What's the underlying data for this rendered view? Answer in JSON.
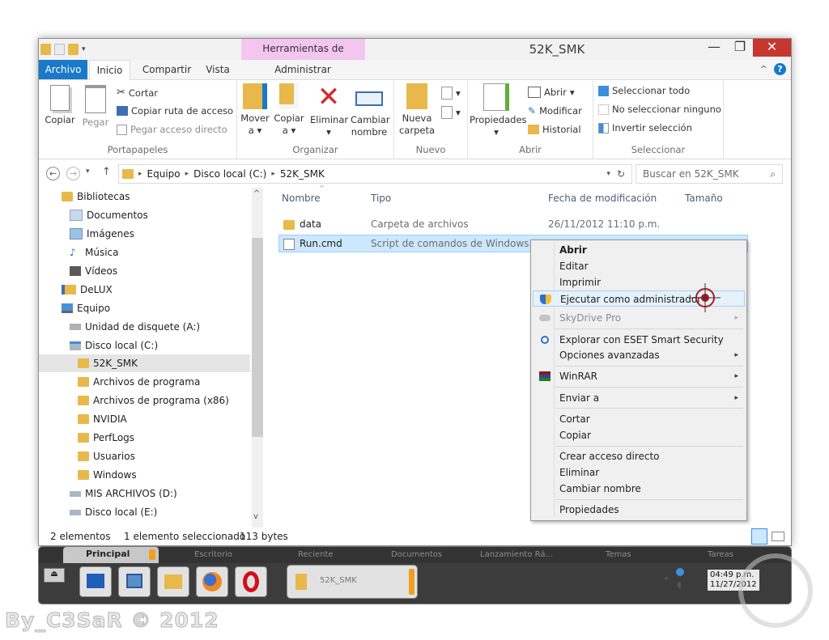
{
  "window": {
    "title": "52K_SMK",
    "context_tab_title": "Herramientas de aplicación",
    "controls": {
      "minimize": "—",
      "maximize": "❐",
      "close": "✕"
    }
  },
  "tabs": [
    "Archivo",
    "Inicio",
    "Compartir",
    "Vista",
    "Administrar"
  ],
  "ribbon": {
    "portapapeles": {
      "label": "Portapapeles",
      "copiar": "Copiar",
      "pegar": "Pegar",
      "cortar": "Cortar",
      "copiar_ruta": "Copiar ruta de acceso",
      "pegar_acceso": "Pegar acceso directo"
    },
    "organizar": {
      "label": "Organizar",
      "mover_a": "Mover",
      "mover_a2": "a",
      "copiar_a": "Copiar",
      "copiar_a2": "a",
      "eliminar": "Eliminar",
      "cambiar": "Cambiar",
      "cambiar2": "nombre"
    },
    "nuevo": {
      "label": "Nuevo",
      "nueva": "Nueva",
      "carpeta": "carpeta"
    },
    "abrir": {
      "label": "Abrir",
      "propiedades": "Propiedades",
      "abrir": "Abrir",
      "modificar": "Modificar",
      "historial": "Historial"
    },
    "seleccionar": {
      "label": "Seleccionar",
      "todo": "Seleccionar todo",
      "ninguno": "No seleccionar ninguno",
      "invertir": "Invertir selección"
    }
  },
  "address": {
    "segments": [
      "Equipo",
      "Disco local (C:)",
      "52K_SMK"
    ],
    "search_placeholder": "Buscar en 52K_SMK"
  },
  "nav_tree": [
    {
      "label": "Bibliotecas",
      "icon": "library-icon"
    },
    {
      "label": "Documentos",
      "icon": "documents-icon"
    },
    {
      "label": "Imágenes",
      "icon": "pictures-icon"
    },
    {
      "label": "Música",
      "icon": "music-icon"
    },
    {
      "label": "Vídeos",
      "icon": "videos-icon"
    },
    {
      "label": "DeLUX",
      "icon": "user-folder-icon"
    },
    {
      "label": "Equipo",
      "icon": "computer-icon"
    },
    {
      "label": "Unidad de disquete (A:)",
      "icon": "floppy-icon"
    },
    {
      "label": "Disco local (C:)",
      "icon": "drive-icon"
    },
    {
      "label": "52K_SMK",
      "icon": "folder-icon"
    },
    {
      "label": "Archivos de programa",
      "icon": "folder-icon"
    },
    {
      "label": "Archivos de programa (x86)",
      "icon": "folder-icon"
    },
    {
      "label": "NVIDIA",
      "icon": "folder-icon"
    },
    {
      "label": "PerfLogs",
      "icon": "folder-icon"
    },
    {
      "label": "Usuarios",
      "icon": "folder-icon"
    },
    {
      "label": "Windows",
      "icon": "folder-icon"
    },
    {
      "label": "MIS ARCHIVOS (D:)",
      "icon": "drive-icon"
    },
    {
      "label": "Disco local (E:)",
      "icon": "drive-icon"
    }
  ],
  "columns": {
    "nombre": "Nombre",
    "tipo": "Tipo",
    "fecha": "Fecha de modificación",
    "tamano": "Tamaño"
  },
  "files": [
    {
      "name": "data",
      "type": "Carpeta de archivos",
      "date": "26/11/2012 11:10 p.m."
    },
    {
      "name": "Run.cmd",
      "type": "Script de comandos de Windows",
      "date": ""
    }
  ],
  "status": {
    "count": "2 elementos",
    "selected": "1 elemento seleccionado",
    "size": "113 bytes"
  },
  "context_menu": {
    "abrir": "Abrir",
    "editar": "Editar",
    "imprimir": "Imprimir",
    "ejecutar_admin": "Ejecutar como administrador",
    "skydrive": "SkyDrive Pro",
    "eset": "Explorar con ESET Smart Security",
    "opciones": "Opciones avanzadas",
    "winrar": "WinRAR",
    "enviar": "Enviar a",
    "cortar": "Cortar",
    "copiar": "Copiar",
    "crear_acceso": "Crear acceso directo",
    "eliminar": "Eliminar",
    "cambiar_nombre": "Cambiar nombre",
    "propiedades": "Propiedades"
  },
  "taskbar": {
    "tabs": [
      "Principal",
      "Escritorio",
      "Reciente",
      "Documentos",
      "Lanzamiento Rá...",
      "Temas",
      "Tareas"
    ],
    "task_label": "52K_SMK",
    "clock_time": "04:49 p.m.",
    "clock_date": "11/27/2012"
  },
  "watermark": "By_C3SaR © 2012",
  "colors": {
    "accent": "#1979ca",
    "context_tab": "#f3c6f0",
    "selection": "#cce8ff",
    "close": "#c7372f"
  }
}
